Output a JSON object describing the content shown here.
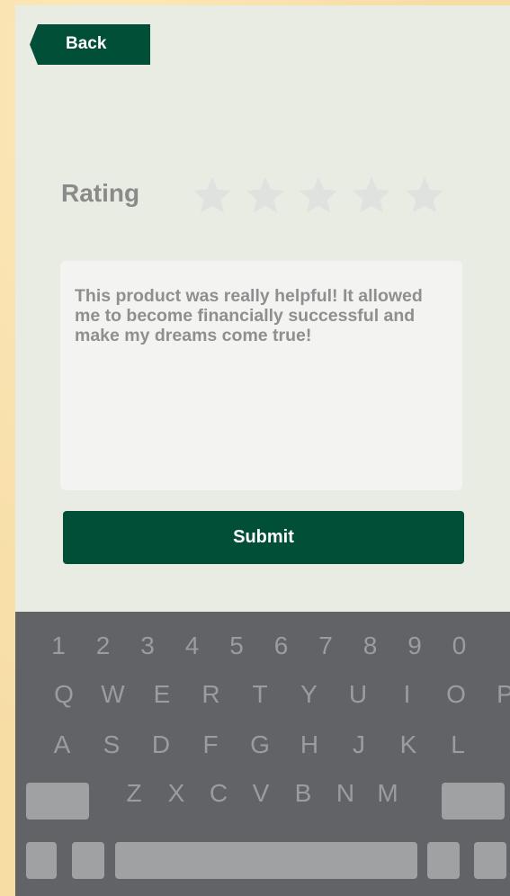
{
  "header": {
    "back_label": "Back"
  },
  "rating": {
    "label": "Rating",
    "stars": 5,
    "selected": 0
  },
  "review": {
    "text": "This product was really helpful! It allowed me to become financially successful and make my dreams come true!"
  },
  "submit": {
    "label": "Submit"
  },
  "keyboard": {
    "row1": [
      "1",
      "2",
      "3",
      "4",
      "5",
      "6",
      "7",
      "8",
      "9",
      "0"
    ],
    "row2": [
      "Q",
      "W",
      "E",
      "R",
      "T",
      "Y",
      "U",
      "I",
      "O",
      "P"
    ],
    "row3": [
      "A",
      "S",
      "D",
      "F",
      "G",
      "H",
      "J",
      "K",
      "L"
    ],
    "row4": [
      "Z",
      "X",
      "C",
      "V",
      "B",
      "N",
      "M"
    ]
  },
  "colors": {
    "brand": "#024f38",
    "screen_bg": "#e8ece2",
    "keyboard_bg": "#626366"
  }
}
